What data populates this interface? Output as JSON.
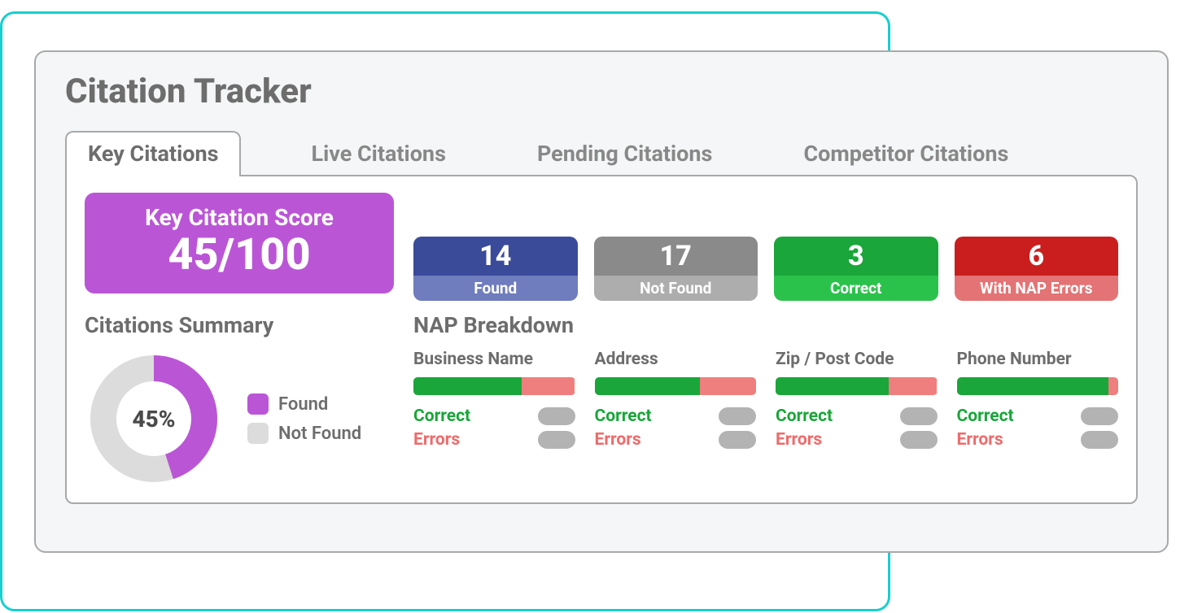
{
  "title": "Citation Tracker",
  "tabs": [
    {
      "label": "Key Citations",
      "active": true
    },
    {
      "label": "Live Citations",
      "active": false
    },
    {
      "label": "Pending Citations",
      "active": false
    },
    {
      "label": "Competitor Citations",
      "active": false
    }
  ],
  "score": {
    "title": "Key Citation Score",
    "value": "45/100"
  },
  "stats": [
    {
      "value": "14",
      "label": "Found",
      "kind": "found"
    },
    {
      "value": "17",
      "label": "Not Found",
      "kind": "notfound"
    },
    {
      "value": "3",
      "label": "Correct",
      "kind": "correct"
    },
    {
      "value": "6",
      "label": "With NAP Errors",
      "kind": "errors"
    }
  ],
  "summary": {
    "title": "Citations Summary",
    "percent_label": "45%",
    "percent": 45,
    "legend_found": "Found",
    "legend_notfound": "Not Found"
  },
  "nap": {
    "title": "NAP Breakdown",
    "row_correct": "Correct",
    "row_errors": "Errors",
    "cols": [
      {
        "title": "Business Name",
        "green": 67
      },
      {
        "title": "Address",
        "green": 65
      },
      {
        "title": "Zip / Post Code",
        "green": 70
      },
      {
        "title": "Phone Number",
        "green": 94
      }
    ]
  },
  "chart_data": {
    "type": "pie",
    "title": "Citations Summary",
    "series": [
      {
        "name": "Found",
        "value": 45,
        "color": "#ba56d6"
      },
      {
        "name": "Not Found",
        "value": 55,
        "color": "#dcdcdc"
      }
    ]
  }
}
